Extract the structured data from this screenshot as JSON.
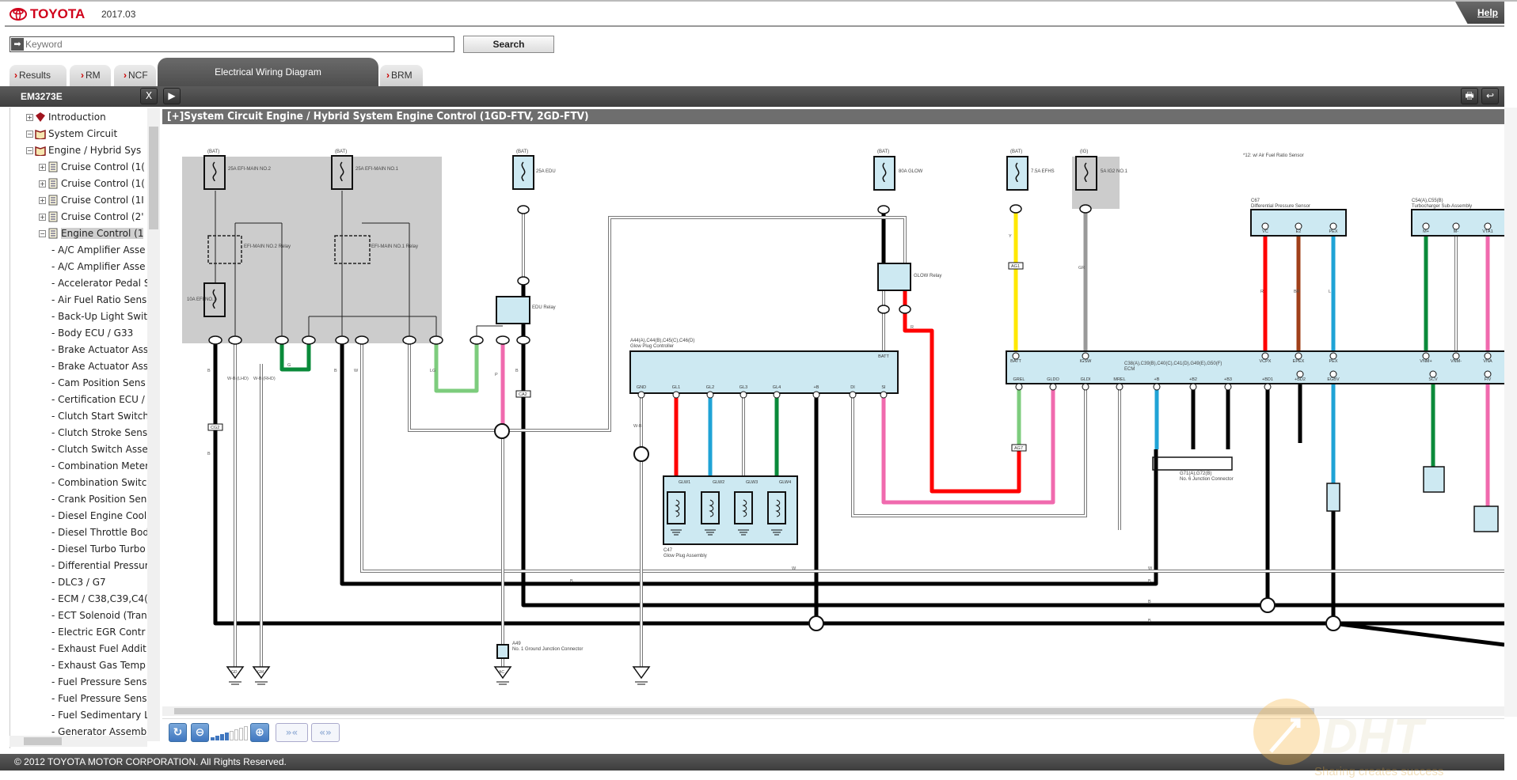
{
  "header": {
    "brand": "TOYOTA",
    "version": "2017.03",
    "help": "Help"
  },
  "search": {
    "placeholder": "Keyword",
    "value": "",
    "button": "Search"
  },
  "tabs": [
    {
      "label": "Results"
    },
    {
      "label": "RM"
    },
    {
      "label": "NCF"
    },
    {
      "label": "Electrical Wiring Diagram",
      "active": true
    },
    {
      "label": "BRM"
    }
  ],
  "sidebar": {
    "title": "EM3273E",
    "close": "X",
    "tree": [
      {
        "label": "Introduction",
        "icon": "book-closed",
        "expanded": false,
        "level": 0
      },
      {
        "label": "System Circuit",
        "icon": "book-open",
        "expanded": true,
        "level": 0
      },
      {
        "label": "Engine / Hybrid Sys",
        "icon": "book-open",
        "expanded": true,
        "level": 1
      },
      {
        "label": "Cruise Control (1(",
        "icon": "document",
        "expanded": false,
        "level": 2
      },
      {
        "label": "Cruise Control (1(",
        "icon": "document",
        "expanded": false,
        "level": 2
      },
      {
        "label": "Cruise Control (1I",
        "icon": "document",
        "expanded": false,
        "level": 2
      },
      {
        "label": "Cruise Control (2'",
        "icon": "document",
        "expanded": false,
        "level": 2
      },
      {
        "label": "Engine Control (1",
        "icon": "document",
        "expanded": true,
        "level": 2,
        "selected": true
      },
      {
        "label": "- A/C Amplifier Asse",
        "level": 3
      },
      {
        "label": "- A/C Amplifier Asse",
        "level": 3
      },
      {
        "label": "- Accelerator Pedal S",
        "level": 3
      },
      {
        "label": "- Air Fuel Ratio Sens",
        "level": 3
      },
      {
        "label": "- Back-Up Light Swit",
        "level": 3
      },
      {
        "label": "- Body ECU / G33",
        "level": 3
      },
      {
        "label": "- Brake Actuator Ass",
        "level": 3
      },
      {
        "label": "- Brake Actuator Ass",
        "level": 3
      },
      {
        "label": "- Cam Position Sens",
        "level": 3
      },
      {
        "label": "- Certification ECU /",
        "level": 3
      },
      {
        "label": "- Clutch Start Switch",
        "level": 3
      },
      {
        "label": "- Clutch Stroke Sens",
        "level": 3
      },
      {
        "label": "- Clutch Switch Asse",
        "level": 3
      },
      {
        "label": "- Combination Meter",
        "level": 3
      },
      {
        "label": "- Combination Switc",
        "level": 3
      },
      {
        "label": "- Crank Position Sen",
        "level": 3
      },
      {
        "label": "- Diesel Engine Cool",
        "level": 3
      },
      {
        "label": "- Diesel Throttle Bod",
        "level": 3
      },
      {
        "label": "- Diesel Turbo Turbo",
        "level": 3
      },
      {
        "label": "- Differential Pressur",
        "level": 3
      },
      {
        "label": "- DLC3 / G7",
        "level": 3
      },
      {
        "label": "- ECM / C38,C39,C4(",
        "level": 3
      },
      {
        "label": "- ECT Solenoid (Tran",
        "level": 3
      },
      {
        "label": "- Electric EGR Contr",
        "level": 3
      },
      {
        "label": "- Exhaust Fuel Addit",
        "level": 3
      },
      {
        "label": "- Exhaust Gas Temp",
        "level": 3
      },
      {
        "label": "- Fuel Pressure Sens",
        "level": 3
      },
      {
        "label": "- Fuel Pressure Sens",
        "level": 3
      },
      {
        "label": "- Fuel Sedimentary L",
        "level": 3
      },
      {
        "label": "- Generator Assembl",
        "level": 3
      }
    ]
  },
  "diagram": {
    "title": "[+]System Circuit  Engine / Hybrid System  Engine Control (1GD-FTV, 2GD-FTV)",
    "labels": {
      "bat": "(BAT)",
      "ig": "(IG)",
      "fuse_efimain2": "25A EFI-MAIN NO.2",
      "fuse_efimain1": "25A EFI-MAIN NO.1",
      "fuse_efi1": "10A EFI NO.1",
      "fuse_edu": "25A EDU",
      "fuse_glow": "80A GLOW",
      "fuse_efhs": "7.5A EFHS",
      "fuse_ig2": "5A IG2 NO.1",
      "relay_efimain2": "EFI-MAIN NO.2 Relay",
      "relay_efimain1": "EFI-MAIN NO.1 Relay",
      "relay_edu": "EDU Relay",
      "relay_glow": "GLOW Relay",
      "note": "*12: w/ Air Fuel Ratio Sensor",
      "glow_ctrl_id": "A44(A),C44(B),C45(C),C46(D)",
      "glow_ctrl": "Glow Plug Controller",
      "glow_assy_id": "C47",
      "glow_assy": "Glow Plug Assembly",
      "ecm_id": "C38(A),C39(B),C40(C),C41(D),G49(E),G50(F)",
      "ecm": "ECM",
      "diff_id": "C67",
      "diff": "Differential Pressure Sensor",
      "turbo_id": "C54(A),C55(B)",
      "turbo": "Turbocharger Sub-Assembly",
      "gjc_id": "A49",
      "gjc": "No. 1 Ground Junction Connector",
      "jc_id": "G71(A),G72(B)",
      "jc": "No. 6 Junction Connector",
      "ag1": "AG1",
      "ag7": "AG7",
      "ca2": "CA2",
      "cg2": "CG2",
      "gd": "GD",
      "gm": "GM",
      "ac": "AC"
    },
    "pins": {
      "glow_ctrl": [
        "GND",
        "GL1",
        "GL2",
        "GL3",
        "GL4",
        "+B",
        "DI",
        "SI",
        "BATT"
      ],
      "glow_assy": [
        "GLW1",
        "GLW2",
        "GLW3",
        "GLW4"
      ],
      "ecm_top": [
        "BATT",
        "IGSW",
        "VCPX",
        "EPEX",
        "PEX",
        "VNM+",
        "VNM-",
        "VNA"
      ],
      "ecm_bottom": [
        "GREL",
        "GLDO",
        "GLDI",
        "MREL",
        "+B",
        "+B2",
        "+B3",
        "+BD1",
        "+BD2",
        "EGBV",
        "SCV",
        "FIV"
      ],
      "diff": [
        "VC",
        "E2",
        "PEX"
      ],
      "turbo": [
        "M+",
        "M-",
        "VTA1"
      ]
    },
    "wire_colors": {
      "B": "#000000",
      "R": "#ff0000",
      "L": "#1fa3d6",
      "G": "#0a8a3a",
      "LG": "#7dcc7d",
      "P": "#f06aae",
      "Y": "#ffe800",
      "GR": "#999999",
      "BR": "#a0401a",
      "W": "#ffffff"
    },
    "wire_codes": [
      "B",
      "W-B",
      "W",
      "G",
      "LG",
      "P",
      "R",
      "L",
      "Y",
      "GR",
      "BR",
      "W-B (LHD)",
      "W-B (RHD)"
    ],
    "fill_color": "#cde9f2"
  },
  "toolbar": {
    "refresh": "refresh",
    "zoom_level": 4,
    "zoom_levels": 8
  },
  "footer": "© 2012 TOYOTA MOTOR CORPORATION. All Rights Reserved.",
  "watermark": {
    "brand": "DHT",
    "slogan": "Sharing creates success"
  }
}
